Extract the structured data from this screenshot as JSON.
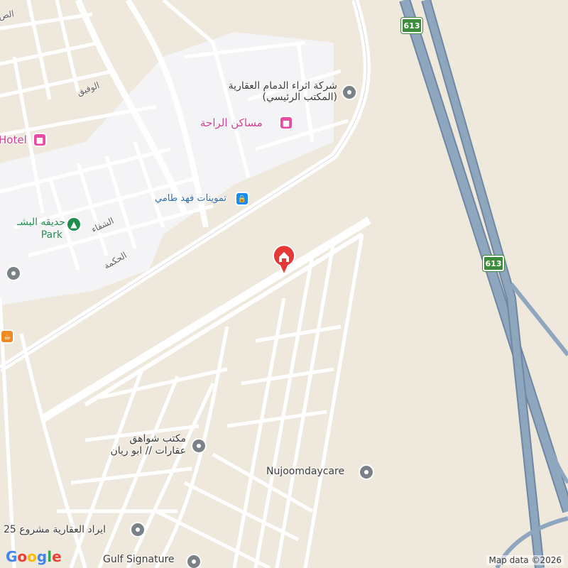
{
  "map": {
    "colors": {
      "background": "#efe9dd",
      "residential": "#f4f4f6",
      "road": "#ffffff",
      "road_edge": "#d6d6d6",
      "highway": "#8fa6bf",
      "highway_edge": "#6f87a0"
    },
    "route_shields": [
      {
        "id": "top",
        "label": "613"
      },
      {
        "id": "right",
        "label": "613"
      }
    ],
    "pois": [
      {
        "id": "ethraa",
        "name_line1": "شركة اثراء الدمام العقارية",
        "name_line2": "(المكتب الرئيسي)",
        "icon": "generic-place-icon"
      },
      {
        "id": "masaken",
        "name": "مساكن الراحة",
        "icon": "hotel-icon"
      },
      {
        "id": "hotel",
        "name": "Hotel",
        "icon": "hotel-icon"
      },
      {
        "id": "tamweenat",
        "name": "تموينات فهد طامي",
        "icon": "shopping-icon"
      },
      {
        "id": "park",
        "name_line1": "حديقه البشـ",
        "name_line2": "Park",
        "icon": "park-icon"
      },
      {
        "id": "shawahiq",
        "name_line1": "مكتب شواهق",
        "name_line2": "عقارات // ابو ريان",
        "icon": "generic-place-icon"
      },
      {
        "id": "nujoom",
        "name": "Nujoomdaycare",
        "icon": "generic-place-icon"
      },
      {
        "id": "irad",
        "name": "ايراد العقارية مشروع 25",
        "icon": "generic-place-icon"
      },
      {
        "id": "gulf",
        "name": "Gulf Signature",
        "icon": "generic-place-icon"
      },
      {
        "id": "cafe",
        "name": "",
        "icon": "cafe-icon"
      },
      {
        "id": "leftplace",
        "name": "",
        "icon": "generic-place-icon"
      }
    ],
    "streets": {
      "alwafeeq": "الوفيق",
      "alshifa": "الشفاء",
      "alhikma": "الحكمة",
      "top_left": "الص"
    },
    "marker": {
      "icon": "home-marker-icon"
    },
    "footer": {
      "logo_letters": [
        "G",
        "o",
        "o",
        "g",
        "l",
        "e"
      ],
      "logo_colors": [
        "#4285f4",
        "#ea4335",
        "#fbbc05",
        "#4285f4",
        "#34a853",
        "#ea4335"
      ],
      "attribution": "Map data ©2026"
    }
  }
}
